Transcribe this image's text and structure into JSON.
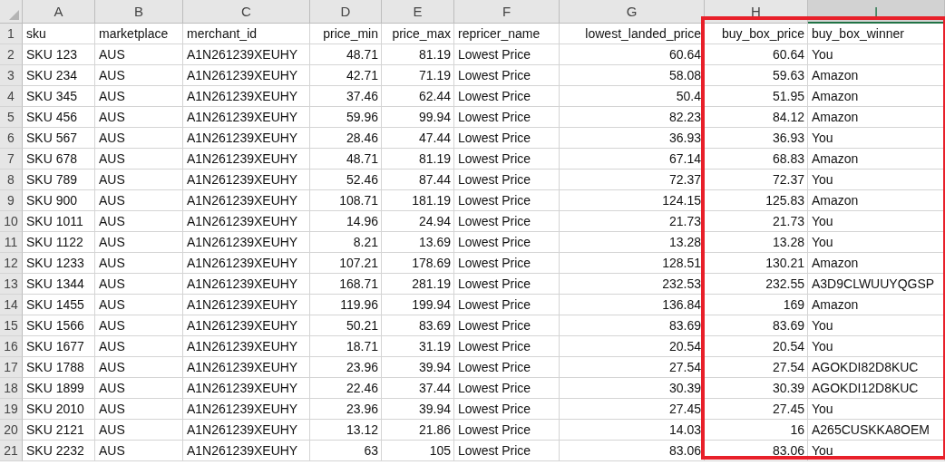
{
  "columns": [
    {
      "letter": "A",
      "kind": "text",
      "selected": false,
      "highlighted": false
    },
    {
      "letter": "B",
      "kind": "text",
      "selected": false,
      "highlighted": false
    },
    {
      "letter": "C",
      "kind": "text",
      "selected": false,
      "highlighted": false
    },
    {
      "letter": "D",
      "kind": "number",
      "selected": false,
      "highlighted": false
    },
    {
      "letter": "E",
      "kind": "number",
      "selected": false,
      "highlighted": false
    },
    {
      "letter": "F",
      "kind": "text",
      "selected": false,
      "highlighted": false
    },
    {
      "letter": "G",
      "kind": "number",
      "selected": false,
      "highlighted": false
    },
    {
      "letter": "H",
      "kind": "number",
      "selected": false,
      "highlighted": true
    },
    {
      "letter": "I",
      "kind": "text",
      "selected": true,
      "highlighted": true
    }
  ],
  "rows": [
    {
      "number": "1",
      "cells": [
        "sku",
        "marketplace",
        "merchant_id",
        "price_min",
        "price_max",
        "repricer_name",
        "lowest_landed_price",
        "buy_box_price",
        "buy_box_winner"
      ]
    },
    {
      "number": "2",
      "cells": [
        "SKU 123",
        "AUS",
        "A1N261239XEUHY",
        "48.71",
        "81.19",
        "Lowest Price",
        "60.64",
        "60.64",
        "You"
      ]
    },
    {
      "number": "3",
      "cells": [
        "SKU 234",
        "AUS",
        "A1N261239XEUHY",
        "42.71",
        "71.19",
        "Lowest Price",
        "58.08",
        "59.63",
        "Amazon"
      ]
    },
    {
      "number": "4",
      "cells": [
        "SKU 345",
        "AUS",
        "A1N261239XEUHY",
        "37.46",
        "62.44",
        "Lowest Price",
        "50.4",
        "51.95",
        "Amazon"
      ]
    },
    {
      "number": "5",
      "cells": [
        "SKU 456",
        "AUS",
        "A1N261239XEUHY",
        "59.96",
        "99.94",
        "Lowest Price",
        "82.23",
        "84.12",
        "Amazon"
      ]
    },
    {
      "number": "6",
      "cells": [
        "SKU 567",
        "AUS",
        "A1N261239XEUHY",
        "28.46",
        "47.44",
        "Lowest Price",
        "36.93",
        "36.93",
        "You"
      ]
    },
    {
      "number": "7",
      "cells": [
        "SKU 678",
        "AUS",
        "A1N261239XEUHY",
        "48.71",
        "81.19",
        "Lowest Price",
        "67.14",
        "68.83",
        "Amazon"
      ]
    },
    {
      "number": "8",
      "cells": [
        "SKU 789",
        "AUS",
        "A1N261239XEUHY",
        "52.46",
        "87.44",
        "Lowest Price",
        "72.37",
        "72.37",
        "You"
      ]
    },
    {
      "number": "9",
      "cells": [
        "SKU 900",
        "AUS",
        "A1N261239XEUHY",
        "108.71",
        "181.19",
        "Lowest Price",
        "124.15",
        "125.83",
        "Amazon"
      ]
    },
    {
      "number": "10",
      "cells": [
        "SKU 1011",
        "AUS",
        "A1N261239XEUHY",
        "14.96",
        "24.94",
        "Lowest Price",
        "21.73",
        "21.73",
        "You"
      ]
    },
    {
      "number": "11",
      "cells": [
        "SKU 1122",
        "AUS",
        "A1N261239XEUHY",
        "8.21",
        "13.69",
        "Lowest Price",
        "13.28",
        "13.28",
        "You"
      ]
    },
    {
      "number": "12",
      "cells": [
        "SKU 1233",
        "AUS",
        "A1N261239XEUHY",
        "107.21",
        "178.69",
        "Lowest Price",
        "128.51",
        "130.21",
        "Amazon"
      ]
    },
    {
      "number": "13",
      "cells": [
        "SKU 1344",
        "AUS",
        "A1N261239XEUHY",
        "168.71",
        "281.19",
        "Lowest Price",
        "232.53",
        "232.55",
        "A3D9CLWUUYQGSP"
      ]
    },
    {
      "number": "14",
      "cells": [
        "SKU 1455",
        "AUS",
        "A1N261239XEUHY",
        "119.96",
        "199.94",
        "Lowest Price",
        "136.84",
        "169",
        "Amazon"
      ]
    },
    {
      "number": "15",
      "cells": [
        "SKU 1566",
        "AUS",
        "A1N261239XEUHY",
        "50.21",
        "83.69",
        "Lowest Price",
        "83.69",
        "83.69",
        "You"
      ]
    },
    {
      "number": "16",
      "cells": [
        "SKU 1677",
        "AUS",
        "A1N261239XEUHY",
        "18.71",
        "31.19",
        "Lowest Price",
        "20.54",
        "20.54",
        "You"
      ]
    },
    {
      "number": "17",
      "cells": [
        "SKU 1788",
        "AUS",
        "A1N261239XEUHY",
        "23.96",
        "39.94",
        "Lowest Price",
        "27.54",
        "27.54",
        "AGOKDI82D8KUC"
      ]
    },
    {
      "number": "18",
      "cells": [
        "SKU 1899",
        "AUS",
        "A1N261239XEUHY",
        "22.46",
        "37.44",
        "Lowest Price",
        "30.39",
        "30.39",
        "AGOKDI12D8KUC"
      ]
    },
    {
      "number": "19",
      "cells": [
        "SKU 2010",
        "AUS",
        "A1N261239XEUHY",
        "23.96",
        "39.94",
        "Lowest Price",
        "27.45",
        "27.45",
        "You"
      ]
    },
    {
      "number": "20",
      "cells": [
        "SKU 2121",
        "AUS",
        "A1N261239XEUHY",
        "13.12",
        "21.86",
        "Lowest Price",
        "14.03",
        "16",
        "A265CUSKKA8OEM"
      ]
    },
    {
      "number": "21",
      "cells": [
        "SKU 2232",
        "AUS",
        "A1N261239XEUHY",
        "63",
        "105",
        "Lowest Price",
        "83.06",
        "83.06",
        "You"
      ]
    }
  ]
}
